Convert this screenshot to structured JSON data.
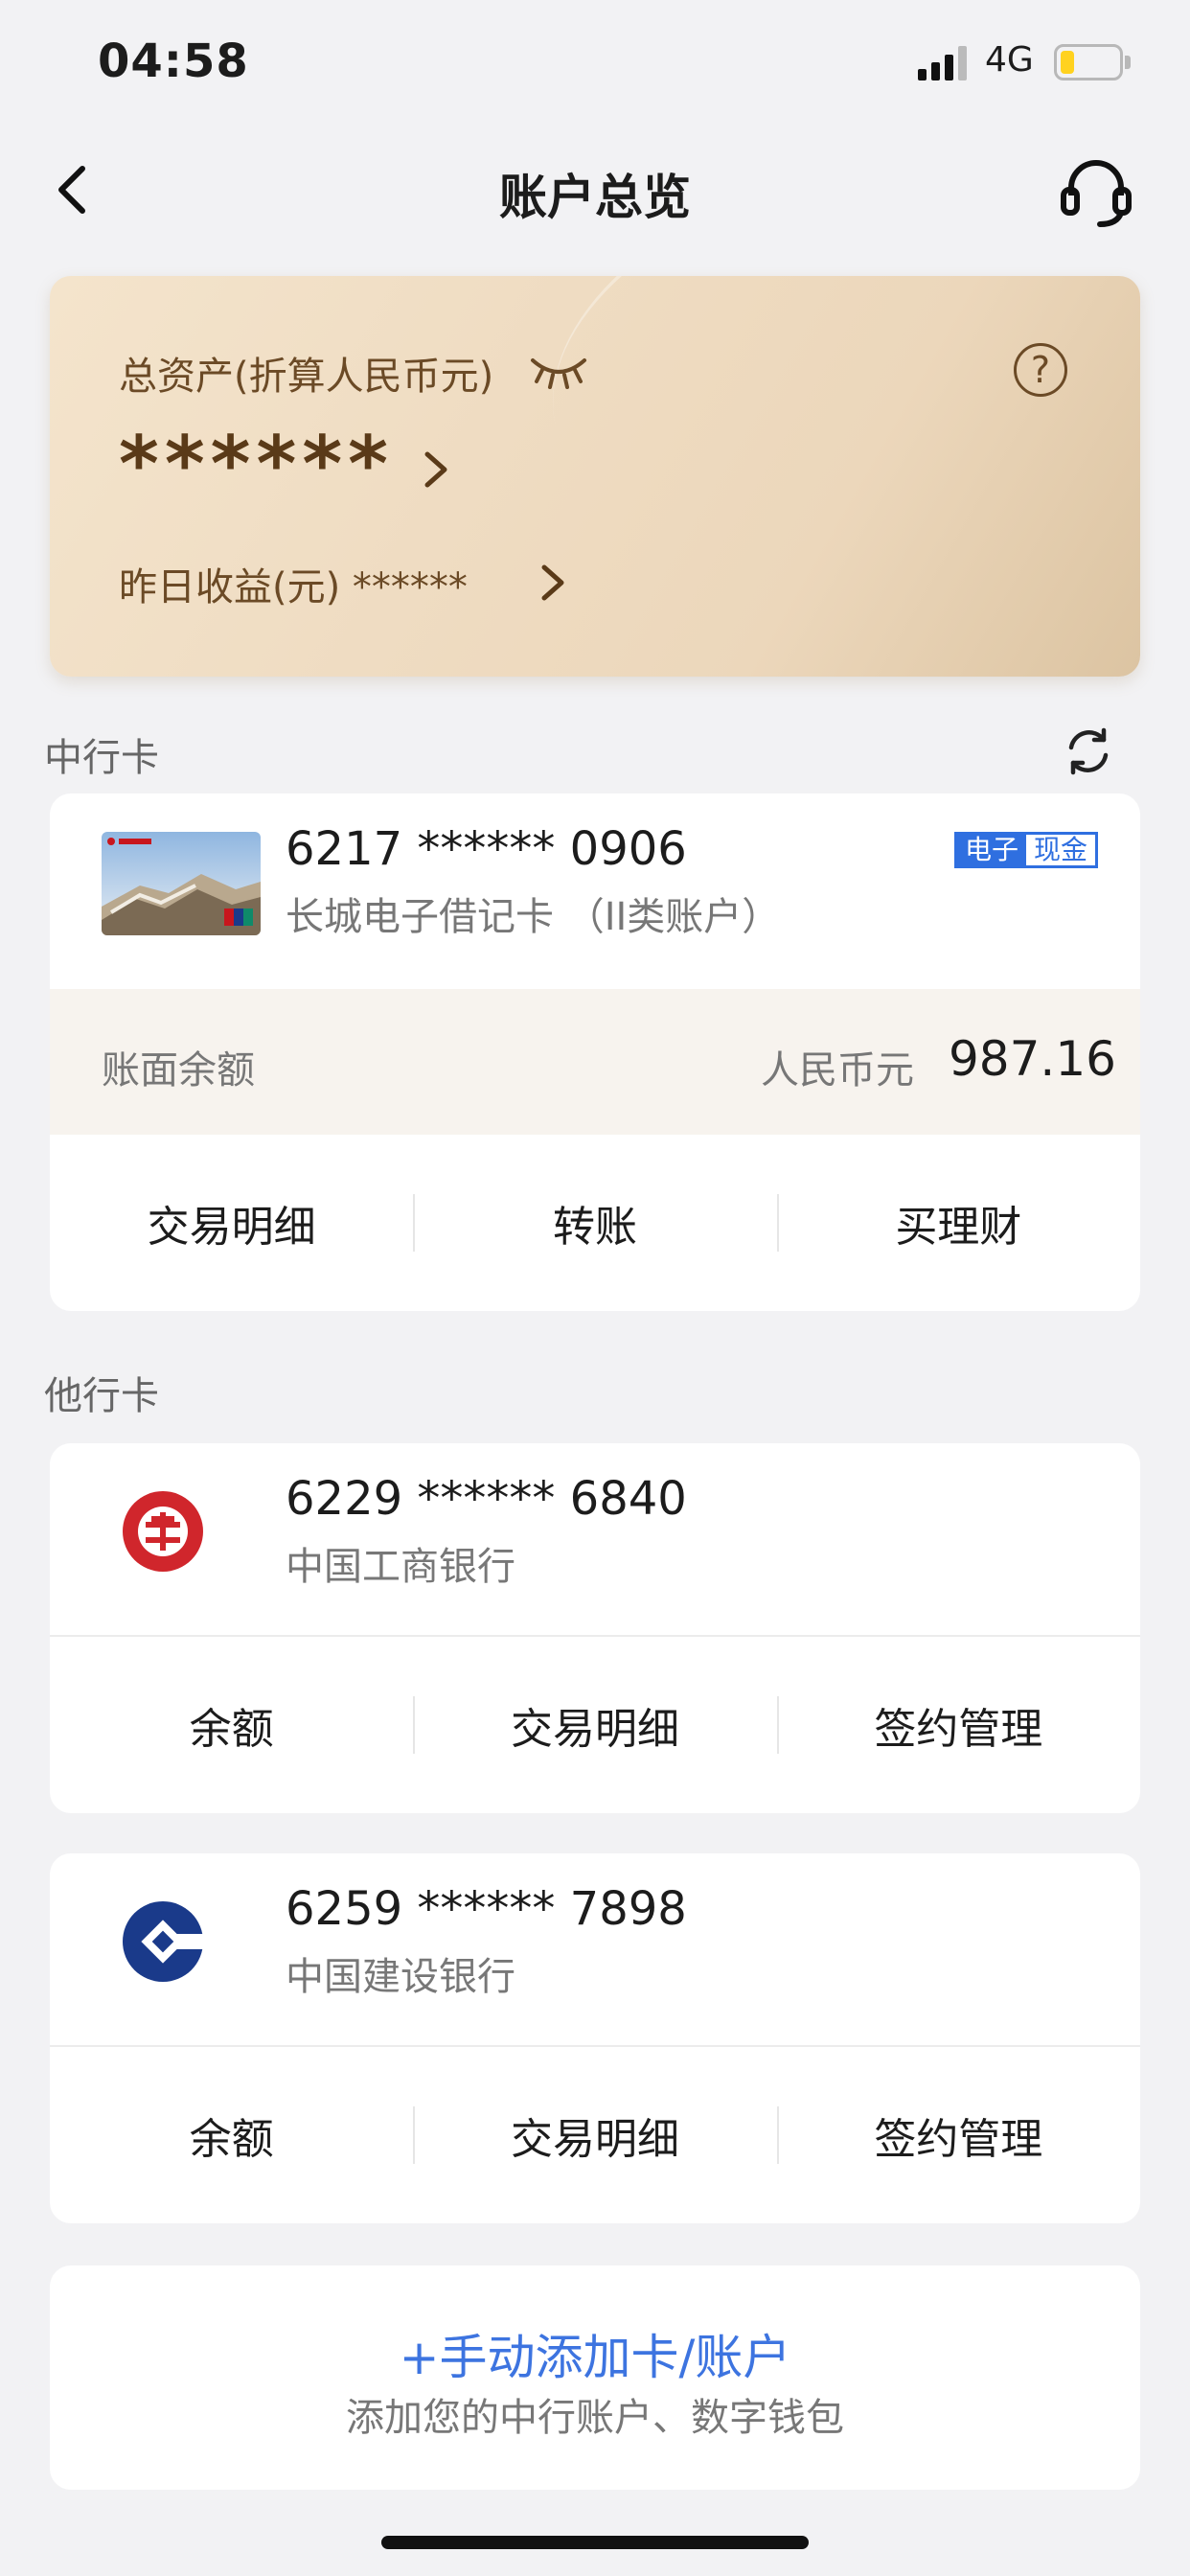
{
  "status_bar": {
    "time": "04:58",
    "network": "4G"
  },
  "nav": {
    "title": "账户总览"
  },
  "assets": {
    "label": "总资产(折算人民币元)",
    "value": "******",
    "yesterday_label": "昨日收益(元) ******",
    "help": "?"
  },
  "boc_section": {
    "title": "中行卡",
    "card": {
      "number": "6217 ****** 0906",
      "name": "长城电子借记卡 （II类账户）",
      "badge_left": "电子",
      "badge_right": "现金",
      "balance_label": "账面余额",
      "currency": "人民币元",
      "amount": "987.16",
      "actions": [
        "交易明细",
        "转账",
        "买理财"
      ]
    }
  },
  "other_section": {
    "title": "他行卡",
    "cards": [
      {
        "number": "6229 ****** 6840",
        "bank": "中国工商银行",
        "actions": [
          "余额",
          "交易明细",
          "签约管理"
        ]
      },
      {
        "number": "6259 ****** 7898",
        "bank": "中国建设银行",
        "actions": [
          "余额",
          "交易明细",
          "签约管理"
        ]
      }
    ]
  },
  "add_account": {
    "title": "+手动添加卡/账户",
    "subtitle": "添加您的中行账户、数字钱包"
  },
  "colors": {
    "accent_blue": "#3d74e0",
    "gold_text": "#6b4a26",
    "icbc_red": "#d0262c",
    "ccb_blue": "#1a3a8a"
  }
}
